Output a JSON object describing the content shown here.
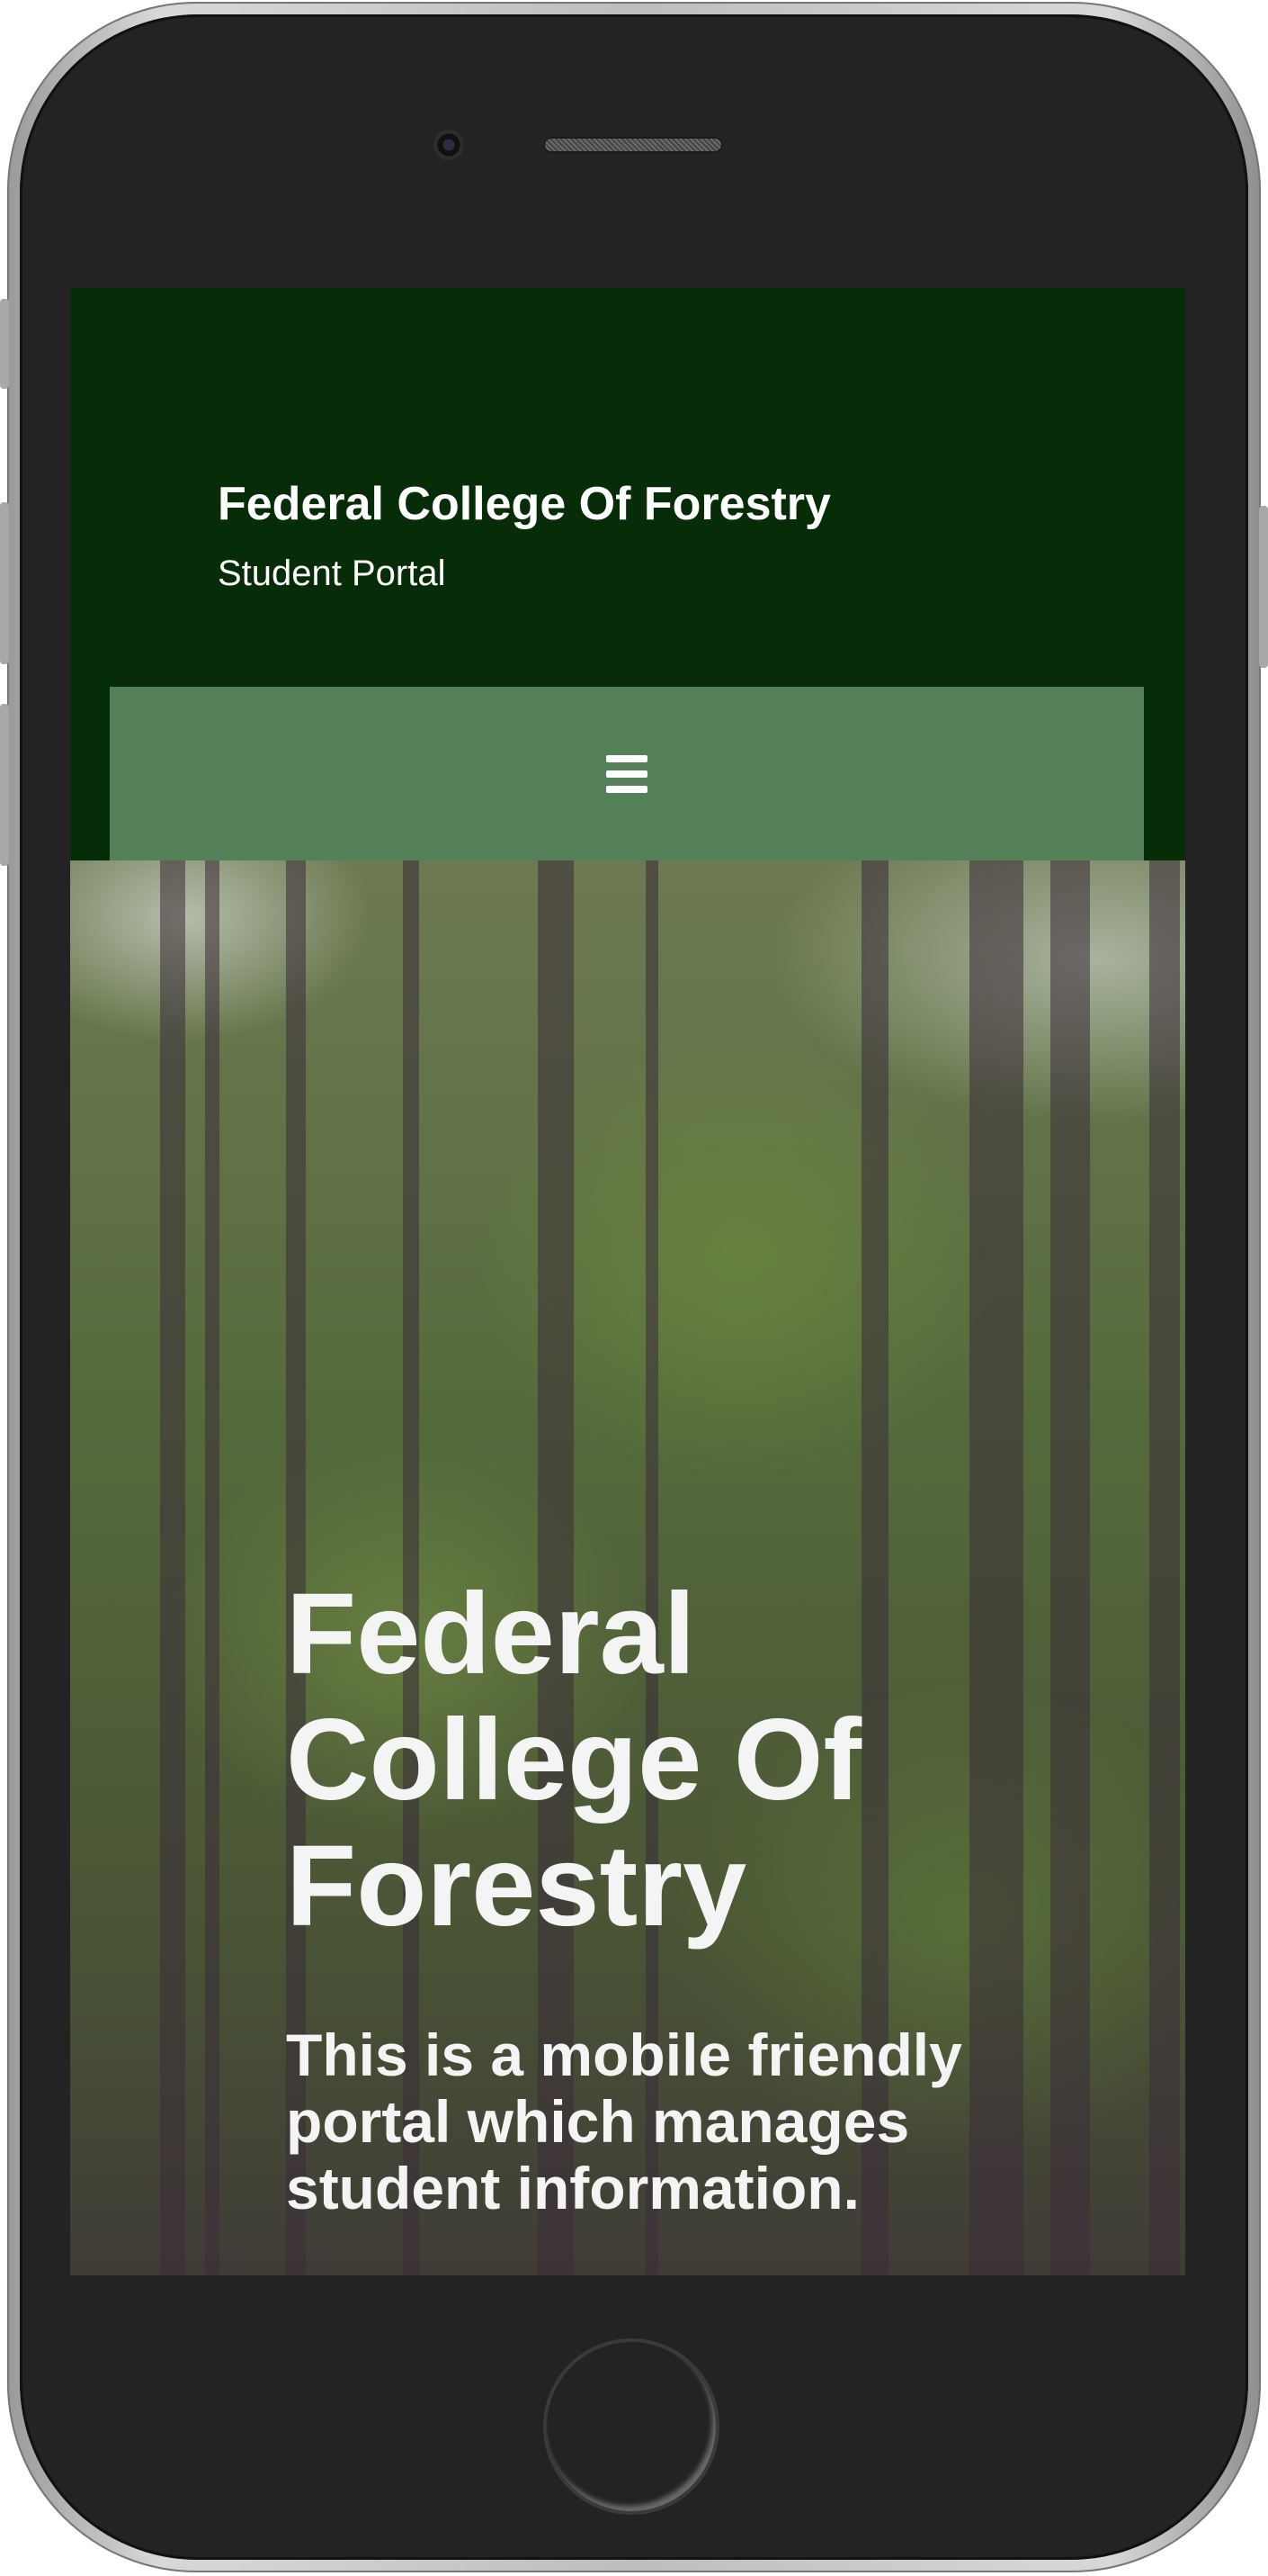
{
  "header": {
    "site_title": "Federal College Of Forestry",
    "site_subtitle": "Student Portal"
  },
  "navigation": {
    "menu_icon": "hamburger-menu-icon"
  },
  "hero": {
    "title": "Federal College Of Forestry",
    "subtitle": "This is a mobile friendly portal which manages student information.",
    "background": "forest-photo"
  },
  "colors": {
    "header_bg": "#072c08",
    "menu_bar_bg": "#548158",
    "text": "#ffffff"
  }
}
